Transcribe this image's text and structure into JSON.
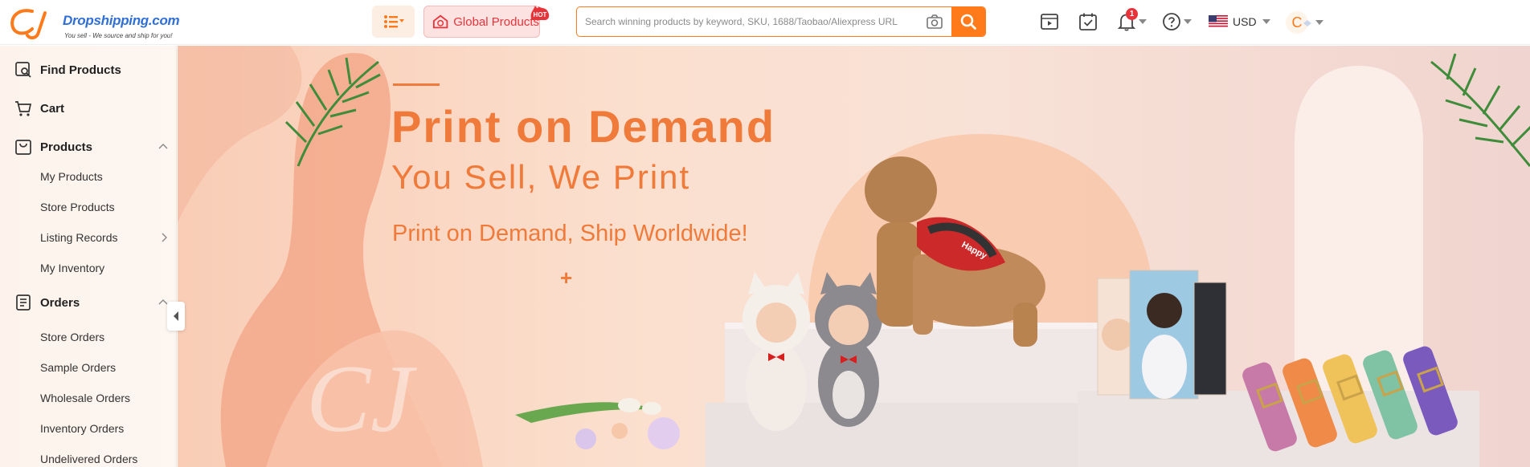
{
  "header": {
    "logo_brand": "Dropshipping.com",
    "logo_tagline": "You sell - We source and ship for you!",
    "global_products_label": "Global Products",
    "hot_badge": "HOT",
    "search_placeholder": "Search winning products by keyword, SKU, 1688/Taobao/Aliexpress URL",
    "notification_count": "1",
    "currency": "USD",
    "avatar_initial": "C"
  },
  "sidebar": {
    "sections": [
      {
        "label": "Find Products",
        "icon": "find-products-icon"
      },
      {
        "label": "Cart",
        "icon": "cart-icon"
      },
      {
        "label": "Products",
        "icon": "products-bag-icon",
        "expanded": true,
        "items": [
          "My Products",
          "Store Products",
          "Listing Records",
          "My Inventory"
        ]
      },
      {
        "label": "Orders",
        "icon": "orders-icon",
        "expanded": true,
        "items": [
          "Store Orders",
          "Sample Orders",
          "Wholesale Orders",
          "Inventory Orders",
          "Undelivered Orders"
        ]
      }
    ]
  },
  "banner": {
    "title": "Print on Demand",
    "subtitle": "You Sell, We Print",
    "tagline": "Print on Demand, Ship Worldwide!",
    "plus": "+",
    "dog_vest_text": "Happy",
    "watermark": "CJ"
  },
  "colors": {
    "accent": "#ff7a1a",
    "banner_text": "#f07a3a",
    "hot": "#e8333a",
    "brand_blue": "#2f6fd6"
  }
}
